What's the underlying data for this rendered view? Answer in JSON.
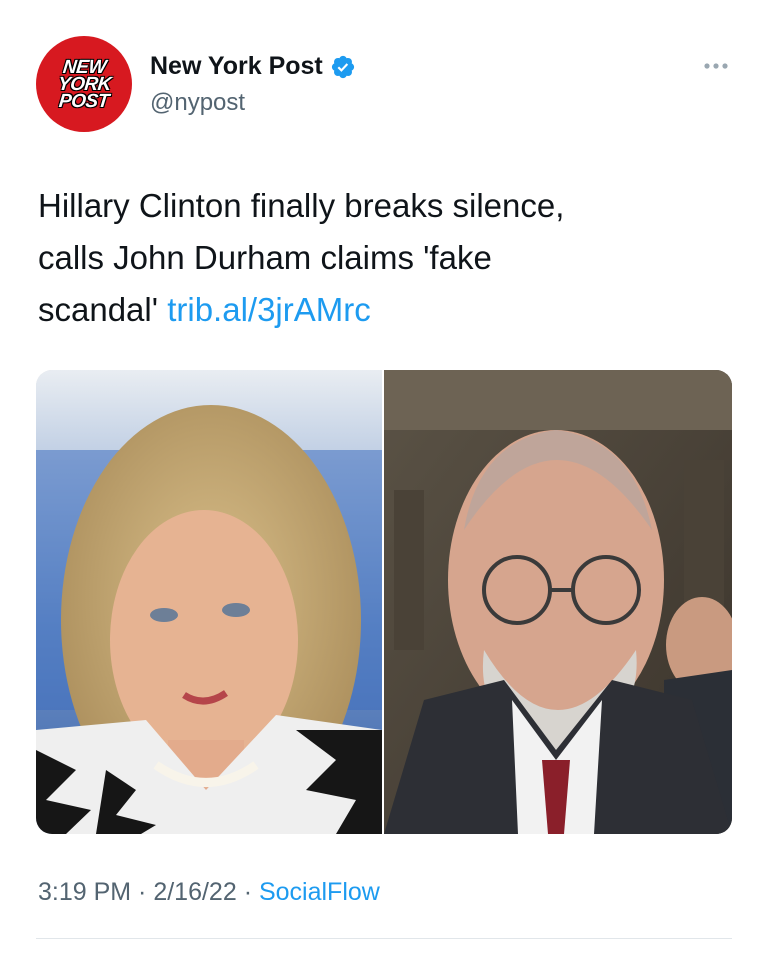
{
  "account": {
    "logo_lines": [
      "NEW",
      "YORK",
      "POST"
    ],
    "display_name": "New York Post",
    "handle": "@nypost",
    "verified": true
  },
  "tweet": {
    "text_lines": [
      "Hillary Clinton finally breaks silence,",
      "calls John Durham claims 'fake",
      "scandal' "
    ],
    "link": "trib.al/3jrAMrc"
  },
  "meta": {
    "time": "3:19 PM",
    "separator": " · ",
    "date": "2/16/22",
    "source": "SocialFlow"
  },
  "colors": {
    "brand_red": "#d71920",
    "link_blue": "#1d9bf0",
    "text": "#0f1419",
    "muted": "#536471"
  },
  "icons": [
    "verified-badge-icon",
    "more-options-icon"
  ]
}
